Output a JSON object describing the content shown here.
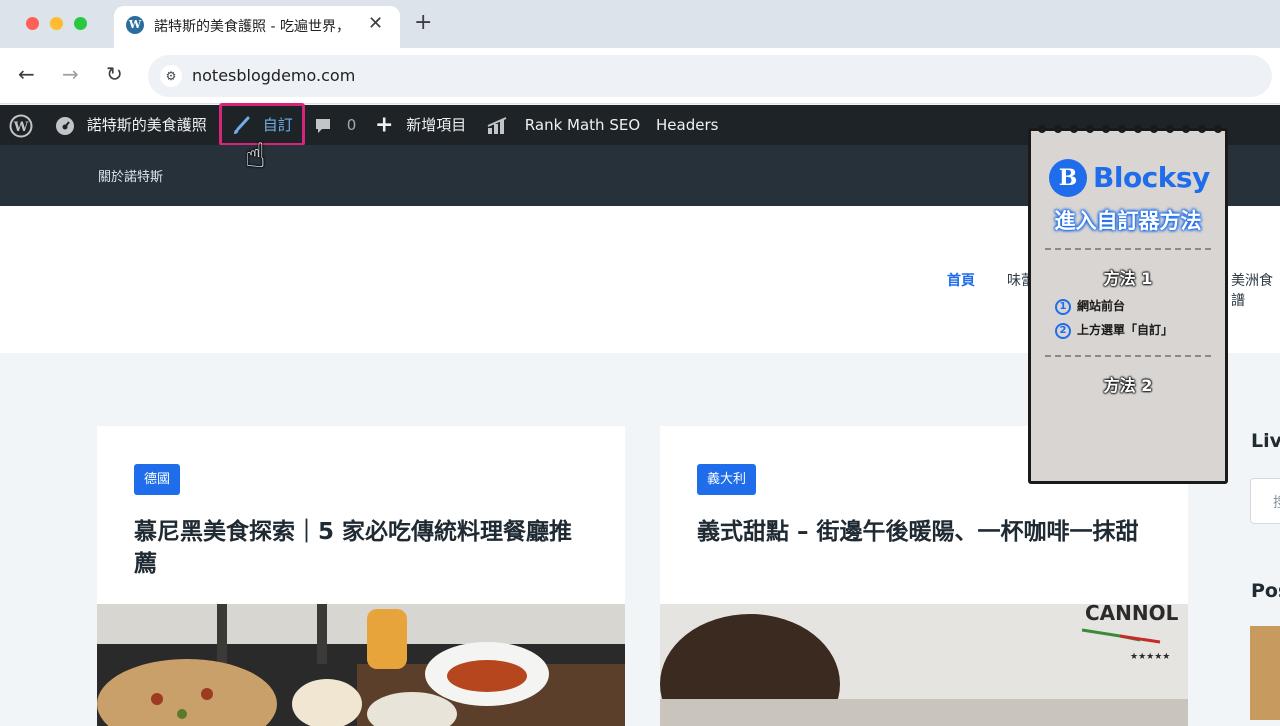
{
  "browser": {
    "tab_title": "諾特斯的美食護照 - 吃遍世界，",
    "url": "notesblogdemo.com",
    "new_tab_label": "+",
    "close_label": "✕"
  },
  "admin_bar": {
    "site_name": "諾特斯的美食護照",
    "customize_label": "自訂",
    "comments_count": "0",
    "new_item_label": "新增項目",
    "rank_math_label": "Rank Math SEO",
    "headers_label": "Headers"
  },
  "site_header": {
    "top_link": "關於諾特斯"
  },
  "main_nav": {
    "items": [
      "首頁",
      "味蕾",
      "美洲食譜"
    ]
  },
  "posts": [
    {
      "category": "德國",
      "title": "慕尼黑美食探索｜5 家必吃傳統料理餐廳推薦"
    },
    {
      "category": "義大利",
      "title": "義式甜點 – 街邊午後暖陽、一杯咖啡一抹甜"
    }
  ],
  "sidebar": {
    "live_label": "Liv",
    "search_placeholder": "搜",
    "posts_label": "Pos"
  },
  "note": {
    "brand": "Blocksy",
    "title": "進入自訂器方法",
    "method1": "方法 1",
    "steps": [
      {
        "num": "1",
        "text": "網站前台"
      },
      {
        "num": "2",
        "text": "上方選單「自訂」"
      }
    ],
    "method2": "方法 2"
  },
  "image_text": {
    "shirt_print": "CANNOL"
  },
  "colors": {
    "admin_bar": "#1d2327",
    "highlight": "#d6257a",
    "accent": "#1f6dea"
  }
}
